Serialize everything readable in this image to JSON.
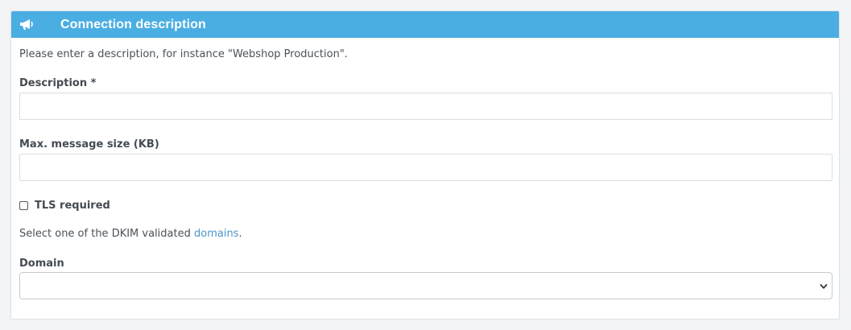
{
  "panel": {
    "title": "Connection description",
    "header_icon": "megaphone-icon",
    "accent_color": "#4aaee3"
  },
  "intro_text": "Please enter a description, for instance \"Webshop Production\".",
  "description_field": {
    "label": "Description *",
    "value": "",
    "placeholder": ""
  },
  "max_size_field": {
    "label": "Max. message size (KB)",
    "value": "",
    "placeholder": ""
  },
  "tls_checkbox": {
    "label": "TLS required",
    "checked": false
  },
  "dkim": {
    "text_before": "Select one of the DKIM validated ",
    "link_text": "domains",
    "text_after": "."
  },
  "domain_field": {
    "label": "Domain",
    "selected": ""
  }
}
